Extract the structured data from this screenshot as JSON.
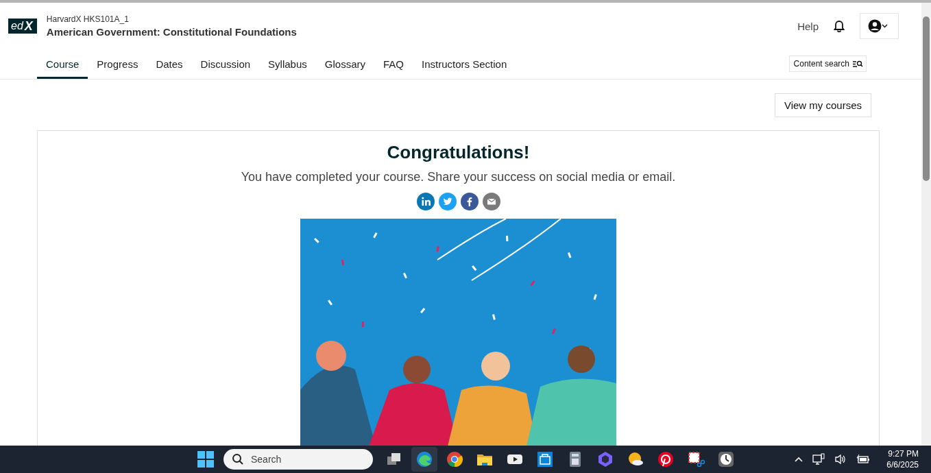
{
  "header": {
    "logo": [
      "ed",
      "X"
    ],
    "course_code": "HarvardX HKS101A_1",
    "course_title": "American Government: Constitutional Foundations",
    "help": "Help"
  },
  "tabs": [
    {
      "label": "Course",
      "selected": true
    },
    {
      "label": "Progress",
      "selected": false
    },
    {
      "label": "Dates",
      "selected": false
    },
    {
      "label": "Discussion",
      "selected": false
    },
    {
      "label": "Syllabus",
      "selected": false
    },
    {
      "label": "Glossary",
      "selected": false
    },
    {
      "label": "FAQ",
      "selected": false
    },
    {
      "label": "Instructors Section",
      "selected": false
    }
  ],
  "content_search": "Content search",
  "view_courses": "View my courses",
  "card": {
    "title": "Congratulations!",
    "message": "You have completed your course. Share your success on social media or email.",
    "share": [
      {
        "kind": "linkedin"
      },
      {
        "kind": "twitter"
      },
      {
        "kind": "facebook"
      },
      {
        "kind": "email"
      }
    ]
  },
  "taskbar": {
    "search_placeholder": "Search",
    "apps": [
      {
        "kind": "taskview",
        "selected": false
      },
      {
        "kind": "edge",
        "selected": true
      },
      {
        "kind": "chrome",
        "selected": false
      },
      {
        "kind": "folder",
        "selected": false
      },
      {
        "kind": "video",
        "selected": false
      },
      {
        "kind": "store",
        "selected": false
      },
      {
        "kind": "calculator",
        "selected": false
      },
      {
        "kind": "copilot",
        "selected": false
      },
      {
        "kind": "weather",
        "selected": false
      },
      {
        "kind": "pinterest",
        "selected": false
      },
      {
        "kind": "snip",
        "selected": false
      },
      {
        "kind": "clock",
        "selected": false
      }
    ],
    "time": "9:27 PM",
    "date": "6/6/2025"
  }
}
